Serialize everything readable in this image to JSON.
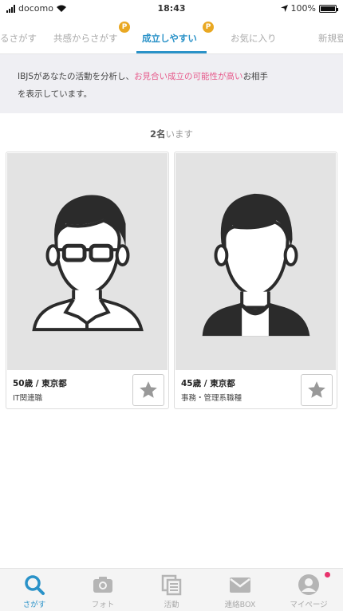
{
  "status_bar": {
    "carrier": "docomo",
    "time": "18:43",
    "battery": "100%"
  },
  "tabs": [
    {
      "label": "るさがす"
    },
    {
      "label": "共感からさがす",
      "badge": "P"
    },
    {
      "label": "成立しやすい",
      "badge": "P",
      "active": true
    },
    {
      "label": "お気に入り"
    },
    {
      "label": "新規登"
    }
  ],
  "banner": {
    "line1_prefix": "IBJSがあなたの活動を分析し、",
    "line1_highlight": "お見合い成立の可能性が高い",
    "line1_suffix": "お相手",
    "line2": "を表示しています。"
  },
  "count": {
    "number": "2名",
    "suffix": "います"
  },
  "profiles": [
    {
      "age_location": "50歳 / 東京都",
      "occupation": "IT関連職",
      "avatar": "man-with-glasses-icon"
    },
    {
      "age_location": "45歳 / 東京都",
      "occupation": "事務・管理系職種",
      "avatar": "man-icon"
    }
  ],
  "bottom_nav": [
    {
      "label": "さがす",
      "icon": "search-icon",
      "active": true
    },
    {
      "label": "フォト",
      "icon": "camera-icon"
    },
    {
      "label": "活動",
      "icon": "documents-icon"
    },
    {
      "label": "連絡BOX",
      "icon": "mail-icon"
    },
    {
      "label": "マイページ",
      "icon": "user-icon"
    }
  ],
  "colors": {
    "accent": "#2a92c8",
    "highlight": "#e75a8b",
    "badge": "#e9a823",
    "notification": "#e8336d"
  }
}
